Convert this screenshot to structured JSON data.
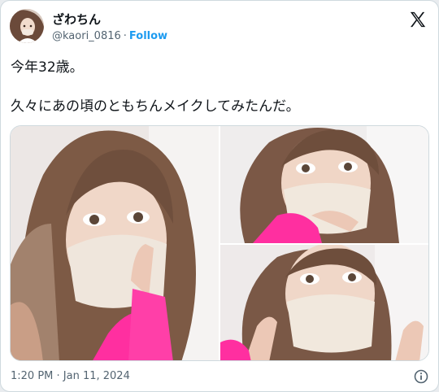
{
  "author": {
    "display_name": "ざわちん",
    "handle": "@kaori_0816",
    "separator": "·",
    "follow_label": "Follow",
    "avatar_icon": "avatar-photo"
  },
  "header": {
    "logo_icon": "x-logo-icon"
  },
  "tweet": {
    "line1": "今年32歳。",
    "line2": "久々にあの頃のともちんメイクしてみたんだ。"
  },
  "media": {
    "photo_count": 3,
    "photos": [
      {
        "alt": "photo-1"
      },
      {
        "alt": "photo-2"
      },
      {
        "alt": "photo-3"
      }
    ]
  },
  "footer": {
    "timestamp": "1:20 PM · Jan 11, 2024",
    "info_icon": "info-icon"
  },
  "colors": {
    "link": "#1d9bf0",
    "text": "#0f1419",
    "secondary": "#536471",
    "border": "#cfd9de",
    "sleeve_pink": "#ff2fa0"
  }
}
